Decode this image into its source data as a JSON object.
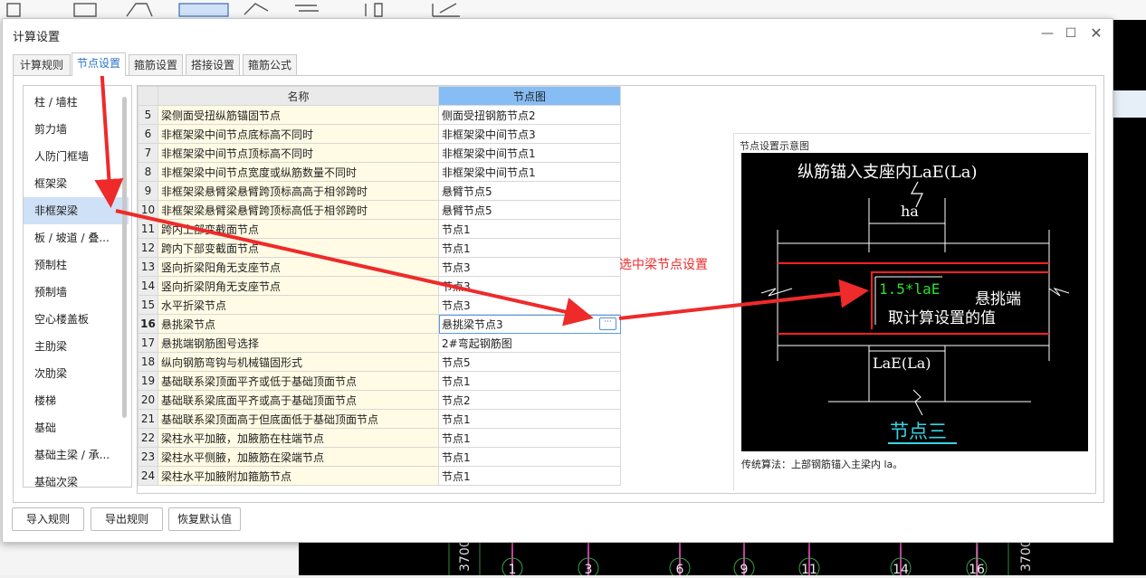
{
  "background": {
    "axis_label_left": "3700",
    "axis_label_right": "3700",
    "axis_numbers": [
      "1",
      "3",
      "6",
      "9",
      "11",
      "14",
      "16"
    ]
  },
  "dialog": {
    "title": "计算设置",
    "minimize_icon": "minimize-icon",
    "maximize_icon": "maximize-icon",
    "close_icon": "close-icon",
    "tabs": [
      "计算规则",
      "节点设置",
      "箍筋设置",
      "搭接设置",
      "箍筋公式"
    ],
    "active_tab": "节点设置"
  },
  "left_list": {
    "items": [
      "柱 / 墙柱",
      "剪力墙",
      "人防门框墙",
      "框架梁",
      "非框架梁",
      "板 / 坡道 / 叠...",
      "预制柱",
      "预制墙",
      "空心楼盖板",
      "主肋梁",
      "次肋梁",
      "楼梯",
      "基础",
      "基础主梁 / 承...",
      "基础次梁"
    ],
    "selected": "非框架梁"
  },
  "grid": {
    "headers": {
      "num": "",
      "name": "名称",
      "node": "节点图"
    },
    "rows": [
      {
        "num": "5",
        "name": "梁侧面受扭纵筋锚固节点",
        "node": "侧面受扭钢筋节点2"
      },
      {
        "num": "6",
        "name": "非框架梁中间节点底标高不同时",
        "node": "非框架梁中间节点3"
      },
      {
        "num": "7",
        "name": "非框架梁中间节点顶标高不同时",
        "node": "非框架梁中间节点1"
      },
      {
        "num": "8",
        "name": "非框架梁中间节点宽度或纵筋数量不同时",
        "node": "非框架梁中间节点1"
      },
      {
        "num": "9",
        "name": "非框架梁悬臂梁悬臂跨顶标高高于相邻跨时",
        "node": "悬臂节点5"
      },
      {
        "num": "10",
        "name": "非框架梁悬臂梁悬臂跨顶标高低于相邻跨时",
        "node": "悬臂节点5"
      },
      {
        "num": "11",
        "name": "跨内上部变截面节点",
        "node": "节点1"
      },
      {
        "num": "12",
        "name": "跨内下部变截面节点",
        "node": "节点1"
      },
      {
        "num": "13",
        "name": "竖向折梁阳角无支座节点",
        "node": "节点3"
      },
      {
        "num": "14",
        "name": "竖向折梁阴角无支座节点",
        "node": "节点3"
      },
      {
        "num": "15",
        "name": "水平折梁节点",
        "node": "节点3"
      },
      {
        "num": "16",
        "name": "悬挑梁节点",
        "node": "悬挑梁节点3"
      },
      {
        "num": "17",
        "name": "悬挑端钢筋图号选择",
        "node": "2#弯起钢筋图"
      },
      {
        "num": "18",
        "name": "纵向钢筋弯钩与机械锚固形式",
        "node": "节点5"
      },
      {
        "num": "19",
        "name": "基础联系梁顶面平齐或低于基础顶面节点",
        "node": "节点1"
      },
      {
        "num": "20",
        "name": "基础联系梁底面平齐或高于基础顶面节点",
        "node": "节点2"
      },
      {
        "num": "21",
        "name": "基础联系梁顶面高于但底面低于基础顶面节点",
        "node": "节点1"
      },
      {
        "num": "22",
        "name": "梁柱水平加腋，加腋筋在柱端节点",
        "node": "节点1"
      },
      {
        "num": "23",
        "name": "梁柱水平侧腋，加腋筋在梁端节点",
        "node": "节点1"
      },
      {
        "num": "24",
        "name": "梁柱水平加腋附加箍筋节点",
        "node": "节点1"
      }
    ],
    "current_row": "16",
    "ellipsis_button": "···"
  },
  "preview": {
    "title": "节点设置示意图",
    "diagram": {
      "top_label": "纵筋锚入支座内LaE(La)",
      "ha": "ha",
      "formula": "1.5*laE",
      "cantilever": "悬挑端",
      "note": "取计算设置的值",
      "bottom_dim": "LaE(La)",
      "node_name": "节点三"
    },
    "caption": "传统算法：上部钢筋锚入主梁内 la。"
  },
  "buttons": {
    "import": "导入规则",
    "export": "导出规则",
    "reset": "恢复默认值"
  },
  "annotation": {
    "text": "选中梁节点设置",
    "color": "#ee2a2a"
  }
}
